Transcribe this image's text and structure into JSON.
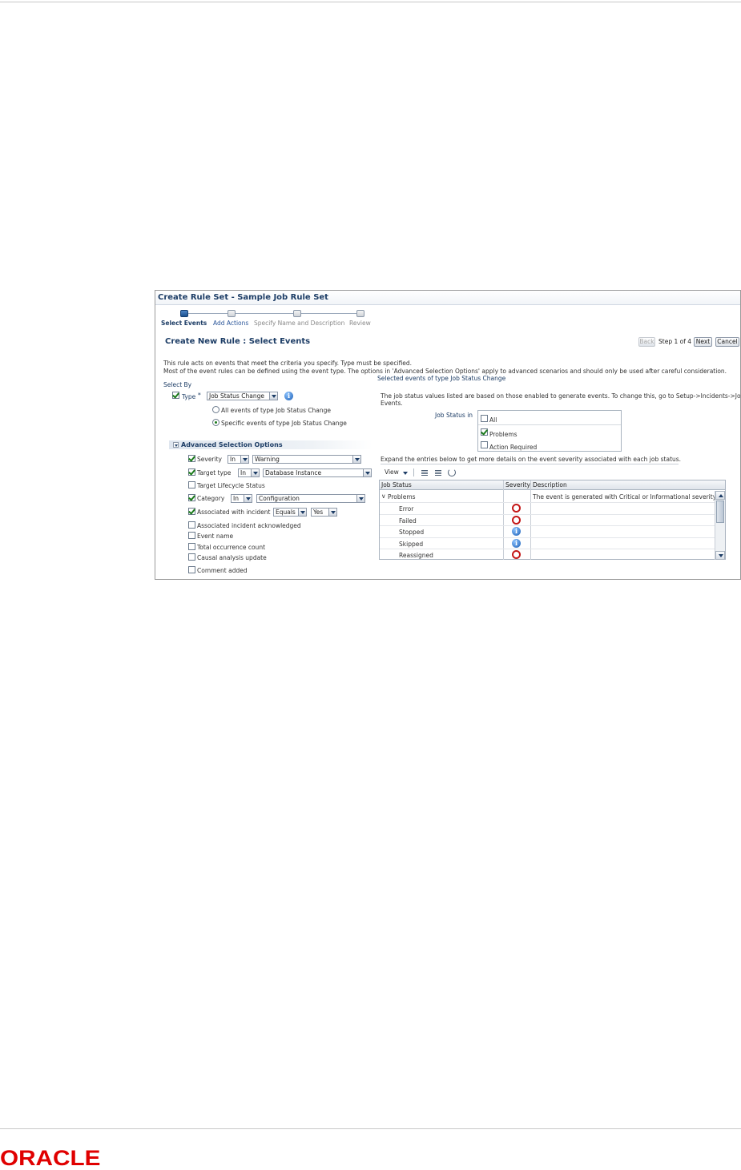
{
  "brand": {
    "logo_text": "ORACLE",
    "logo_color": "#e00000"
  },
  "window": {
    "title": "Create Rule Set - Sample Job Rule Set"
  },
  "train": {
    "steps": [
      {
        "label": "Select Events",
        "state": "active"
      },
      {
        "label": "Add Actions",
        "state": "link"
      },
      {
        "label": "Specify Name and Description",
        "state": "disabled"
      },
      {
        "label": "Review",
        "state": "disabled"
      }
    ]
  },
  "page": {
    "heading": "Create New Rule : Select Events",
    "nav": {
      "back": "Back",
      "step_text": "Step 1 of 4",
      "next": "Next",
      "cancel": "Cancel"
    },
    "intro_line1": "This rule acts on events that meet the criteria you specify. Type must be specified.",
    "intro_line2": "Most of the event rules can be defined using the event type. The options in 'Advanced Selection Options' apply to advanced scenarios and should only be used after careful consideration."
  },
  "select_by": {
    "label": "Select By",
    "type_label": "Type",
    "required_mark": "*",
    "type_value": "Job Status Change",
    "type_checked": true,
    "radio_all": "All events of type Job Status Change",
    "radio_specific": "Specific events of type Job Status Change",
    "selected_radio": "specific"
  },
  "advanced": {
    "title": "Advanced Selection Options",
    "severity": {
      "label": "Severity",
      "checked": true,
      "op": "In",
      "value": "Warning"
    },
    "target_type": {
      "label": "Target type",
      "checked": true,
      "op": "In",
      "value": "Database Instance"
    },
    "target_lifecycle": {
      "label": "Target Lifecycle Status",
      "checked": false
    },
    "category": {
      "label": "Category",
      "checked": true,
      "op": "In",
      "value": "Configuration"
    },
    "associated_incident": {
      "label": "Associated with incident",
      "checked": true,
      "op": "Equals",
      "value": "Yes"
    },
    "incident_ack": {
      "label": "Associated incident acknowledged",
      "checked": false
    },
    "event_name": {
      "label": "Event name",
      "checked": false
    },
    "total_count": {
      "label": "Total occurrence count",
      "checked": false
    },
    "causal": {
      "label": "Causal analysis update",
      "checked": false
    },
    "comment": {
      "label": "Comment added",
      "checked": false
    }
  },
  "right": {
    "section_title": "Selected events of type Job Status Change",
    "note_line1": "The job status values listed are based on those enabled to generate events. To change this, go to Setup->Incidents->Job",
    "note_line2": "Events.",
    "job_status_label": "Job Status in",
    "options": {
      "all": {
        "label": "All",
        "checked": false
      },
      "problems": {
        "label": "Problems",
        "checked": true
      },
      "action_required": {
        "label": "Action Required",
        "checked": false
      }
    },
    "expand_text": "Expand the entries below to get more details on the event severity associated with each job status.",
    "view_label": "View",
    "columns": {
      "job_status": "Job Status",
      "severity": "Severity",
      "description": "Description"
    },
    "rows": [
      {
        "status": "Problems",
        "severity": "",
        "description": "The event is generated with Critical or Informational severity."
      },
      {
        "status": "Error",
        "severity": "critical",
        "description": ""
      },
      {
        "status": "Failed",
        "severity": "critical",
        "description": ""
      },
      {
        "status": "Stopped",
        "severity": "informational",
        "description": ""
      },
      {
        "status": "Skipped",
        "severity": "informational",
        "description": ""
      },
      {
        "status": "Reassigned",
        "severity": "critical",
        "description": ""
      }
    ]
  }
}
